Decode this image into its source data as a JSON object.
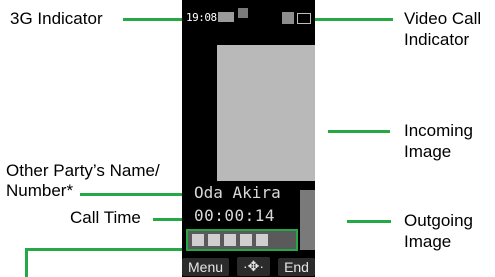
{
  "labels": {
    "indicator_3g": "3G Indicator",
    "video_call": "Video Call",
    "video_call_line2": "Indicator",
    "incoming_image": "Incoming",
    "incoming_image_line2": "Image",
    "other_party": "Other Party’s Name/",
    "other_party_line2": "Number*",
    "call_time": "Call Time",
    "outgoing_image": "Outgoing",
    "outgoing_image_line2": "Image"
  },
  "phone": {
    "clock": "19:08",
    "caller_name": "Oda Akira",
    "call_time": "00:00:14",
    "softkeys": {
      "left": "Menu",
      "center": "·✥·",
      "right": "End"
    }
  },
  "colors": {
    "callout_line": "#27a847"
  }
}
